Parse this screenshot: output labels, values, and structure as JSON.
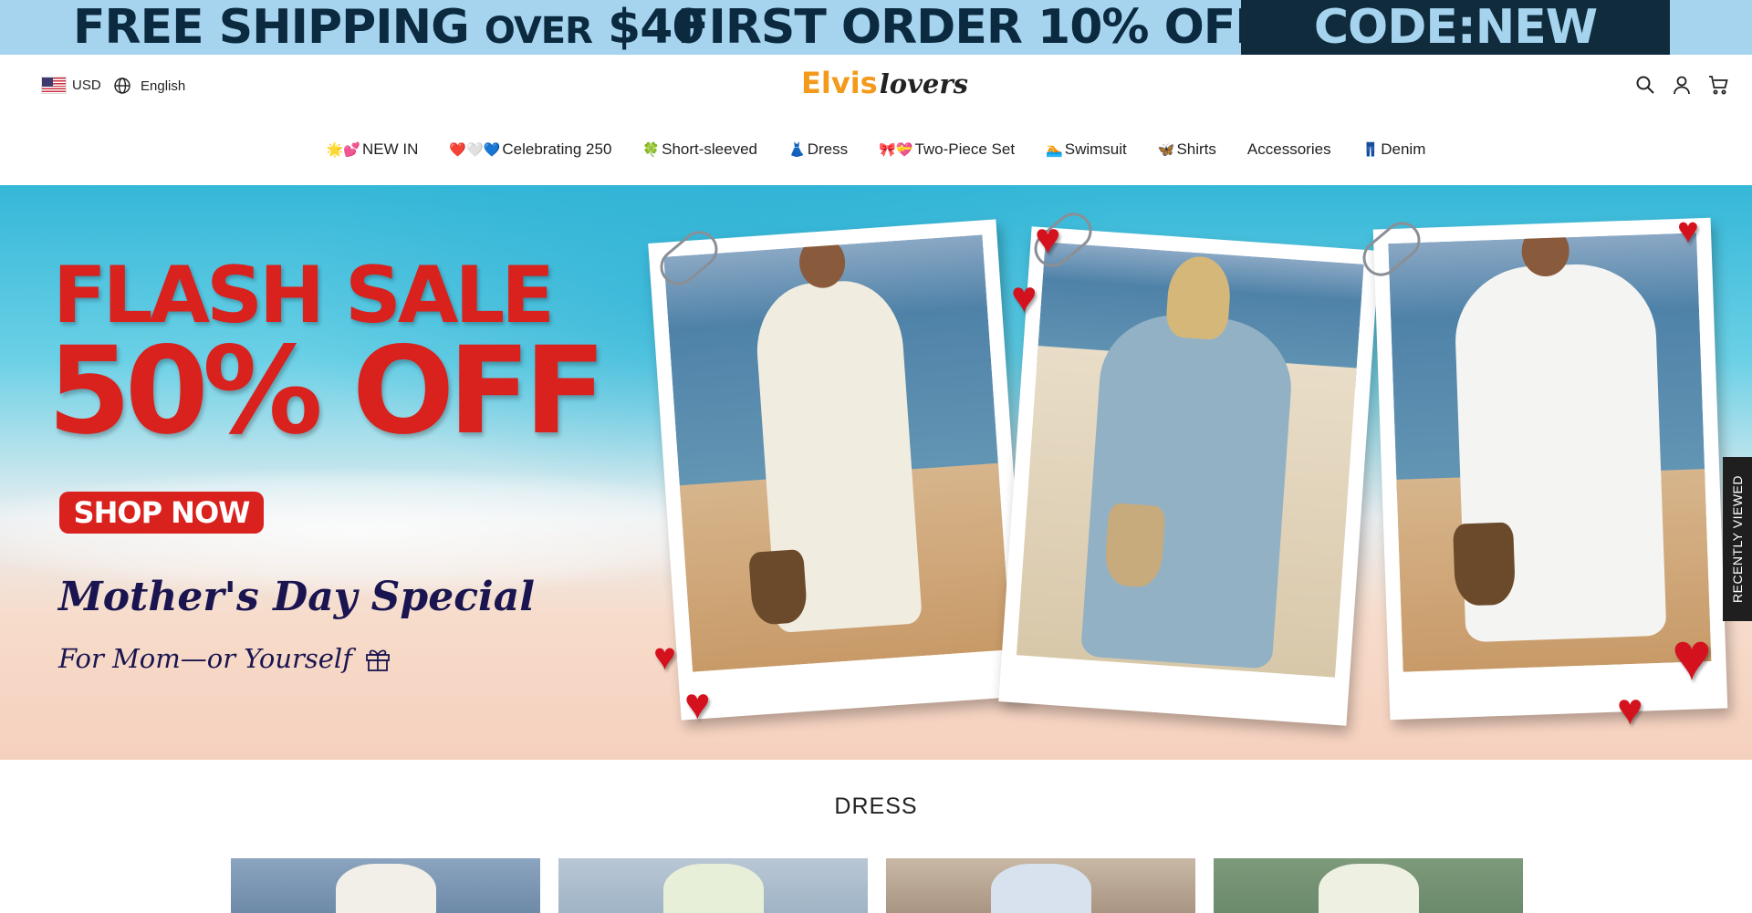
{
  "announcement": {
    "shipping_main": "FREE SHIPPING",
    "shipping_small": "OVER",
    "shipping_amount": "$40",
    "first_order": "FIRST ORDER 10% OFF",
    "code": "CODE:NEW"
  },
  "header": {
    "currency": "USD",
    "language": "English",
    "logo_part1": "Elvis",
    "logo_part2": "lovers"
  },
  "nav": [
    {
      "emoji": "🌟💕",
      "label": "NEW IN"
    },
    {
      "emoji": "❤️🤍💙",
      "label": "Celebrating 250"
    },
    {
      "emoji": "🍀",
      "label": "Short-sleeved"
    },
    {
      "emoji": "👗",
      "label": "Dress"
    },
    {
      "emoji": "🎀💝",
      "label": "Two-Piece Set"
    },
    {
      "emoji": "🏊",
      "label": "Swimsuit"
    },
    {
      "emoji": "🦋",
      "label": "Shirts"
    },
    {
      "emoji": "",
      "label": "Accessories"
    },
    {
      "emoji": "👖",
      "label": "Denim"
    }
  ],
  "hero": {
    "flash": "FLASH SALE",
    "off": "50% OFF",
    "cta": "SHOP NOW",
    "headline": "Mother's Day Special",
    "subline": "For Mom—or Yourself"
  },
  "recently_viewed": "RECENTLY VIEWED",
  "section": {
    "title": "DRESS"
  },
  "colors": {
    "accent_red": "#d9211d",
    "logo_orange": "#f39a1c",
    "announce_bg": "#a6d4ee",
    "code_bg": "#0f2b3c"
  }
}
